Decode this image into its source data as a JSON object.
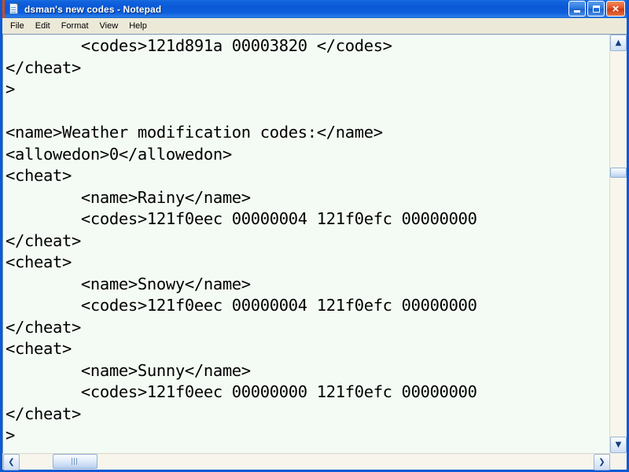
{
  "window": {
    "title": "dsman's new codes - Notepad",
    "icon": "notepad-document-icon",
    "title_bar_color": "#0a58d6",
    "client_background": "#f4fbf4"
  },
  "title_buttons": {
    "minimize_label": "_",
    "maximize_label": "",
    "close_label": "×"
  },
  "menu": {
    "items": [
      {
        "label": "File"
      },
      {
        "label": "Edit"
      },
      {
        "label": "Format"
      },
      {
        "label": "View"
      },
      {
        "label": "Help"
      }
    ]
  },
  "editor": {
    "lines": [
      "        <codes>121d891a 00003820 </codes>",
      "</cheat>",
      ">",
      "",
      "<name>Weather modification codes:</name>",
      "<allowedon>0</allowedon>",
      "<cheat>",
      "        <name>Rainy</name>",
      "        <codes>121f0eec 00000004 121f0efc 00000000",
      "</cheat>",
      "<cheat>",
      "        <name>Snowy</name>",
      "        <codes>121f0eec 00000004 121f0efc 00000000",
      "</cheat>",
      "<cheat>",
      "        <name>Sunny</name>",
      "        <codes>121f0eec 00000000 121f0efc 00000000",
      "</cheat>",
      ">"
    ],
    "text": "        <codes>121d891a 00003820 </codes>\n</cheat>\n>\n\n<name>Weather modification codes:</name>\n<allowedon>0</allowedon>\n<cheat>\n        <name>Rainy</name>\n        <codes>121f0eec 00000004 121f0efc 00000000\n</cheat>\n<cheat>\n        <name>Snowy</name>\n        <codes>121f0eec 00000004 121f0efc 00000000\n</cheat>\n<cheat>\n        <name>Sunny</name>\n        <codes>121f0eec 00000000 121f0efc 00000000\n</cheat>\n>"
  },
  "scrollbars": {
    "vertical": {
      "up_arrow": "▲",
      "down_arrow": "▼"
    },
    "horizontal": {
      "left_arrow": "❮",
      "right_arrow": "❯"
    }
  }
}
